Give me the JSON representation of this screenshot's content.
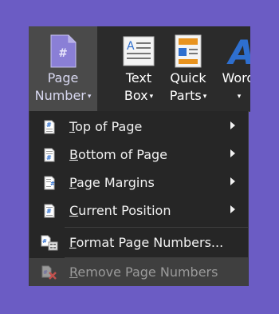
{
  "ribbon": {
    "page_number": {
      "line1": "Page",
      "line2": "Number",
      "caret": "▾"
    },
    "text_box": {
      "line1": "Text",
      "line2": "Box",
      "caret": "▾"
    },
    "quick_parts": {
      "line1": "Quick",
      "line2": "Parts",
      "caret": "▾"
    },
    "wordart": {
      "line1": "Word",
      "caret": "▾"
    }
  },
  "menu": {
    "items": [
      {
        "accel": "T",
        "rest": "op of Page",
        "submenu": true
      },
      {
        "accel": "B",
        "rest": "ottom of Page",
        "submenu": true
      },
      {
        "accel": "P",
        "rest": "age Margins",
        "submenu": true
      },
      {
        "accel": "C",
        "rest": "urrent Position",
        "submenu": true
      },
      {
        "accel": "F",
        "rest": "ormat Page Numbers...",
        "submenu": false
      },
      {
        "accel": "R",
        "rest": "emove Page Numbers",
        "submenu": false,
        "disabled": true
      }
    ]
  },
  "colors": {
    "background": "#6b5cc4",
    "ribbon": "#2b2b2b",
    "menu": "#262626",
    "highlight": "#3f3f3f",
    "icon_blue": "#2e6fcf"
  }
}
